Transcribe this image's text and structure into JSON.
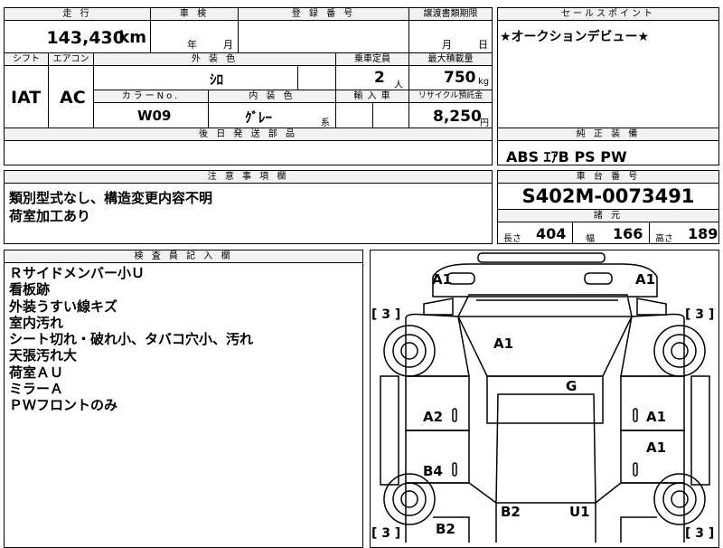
{
  "top_left": {
    "mileage_label": "走 行",
    "mileage_value": "143,430",
    "mileage_unit": "km",
    "inspection_label": "車 検",
    "inspection_year": "年",
    "inspection_month": "月",
    "reg_label": "登 録 番 号",
    "transfer_label": "譲渡書類期限",
    "transfer_month": "月",
    "transfer_day": "日",
    "shift_label": "シフト",
    "shift_value": "IAT",
    "ac_label": "エアコン",
    "ac_value": "AC",
    "ext_color_label": "外 装 色",
    "ext_color_value": "ｼﾛ",
    "capacity_label": "乗車定員",
    "capacity_value": "2",
    "capacity_unit": "人",
    "load_label": "最大積載量",
    "load_value": "750",
    "load_unit": "kg",
    "color_no_label": "カラーNo.",
    "color_no_value": "W09",
    "int_color_label": "内 装 色",
    "int_color_value": "ｸﾞﾚｰ",
    "int_color_suffix": "系",
    "import_label": "輸 入 車",
    "recycle_label": "リサイクル預託金",
    "recycle_value": "8,250",
    "recycle_unit": "円",
    "later_parts_label": "後 日 発 送 部 品"
  },
  "sales_point": {
    "label": "セールスポイント",
    "text": "★オークションデビュー★"
  },
  "equipment": {
    "label": "純 正 装 備",
    "text": "ABS ｴｱB PS PW"
  },
  "notes": {
    "label": "注 意 事 項 欄",
    "line1": "類別型式なし、構造変更内容不明",
    "line2": "荷室加工あり"
  },
  "chassis": {
    "label": "車 台 番 号",
    "value": "S402M-0073491",
    "spec_label": "諸 元",
    "length_label": "長さ",
    "length_value": "404",
    "width_label": "幅",
    "width_value": "166",
    "height_label": "高さ",
    "height_value": "189"
  },
  "inspector": {
    "label": "検 査 員 記 入 欄",
    "lines": [
      "Ｒサイドメンバー小Ｕ",
      "看板跡",
      "外装うすい線キズ",
      "室内汚れ",
      "シート切れ・破れ小、タバコ穴小、汚れ",
      "天張汚れ大",
      "荷室ＡＵ",
      "ミラーＡ",
      "ＰＷフロントのみ"
    ]
  },
  "diagram": {
    "marks": [
      "A1",
      "A1",
      "A1",
      "G",
      "A2",
      "A1",
      "A1",
      "B4",
      "B2",
      "U1",
      "B2"
    ],
    "tire_depth": "3"
  }
}
